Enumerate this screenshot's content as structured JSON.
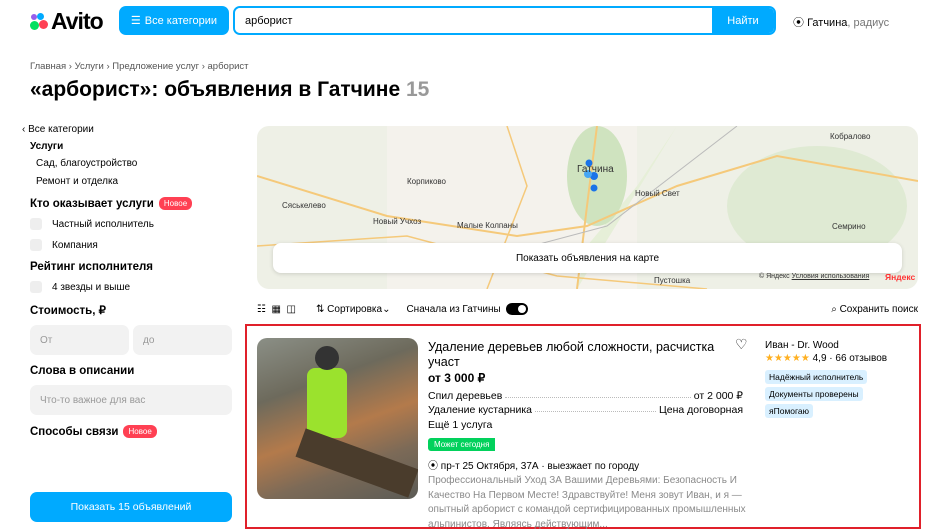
{
  "header": {
    "logo": "Avito",
    "categories_button": "Все категории",
    "search_value": "арборист",
    "search_button": "Найти",
    "location_city": "Гатчина",
    "location_suffix": ", радиус"
  },
  "breadcrumbs": "Главная › Услуги › Предложение услуг › арборист",
  "page_title": "«арборист»: объявления в Гатчине",
  "result_count": "15",
  "sidebar": {
    "back": "Все категории",
    "section": "Услуги",
    "subitems": [
      "Сад, благоустройство",
      "Ремонт и отделка"
    ],
    "provider_title": "Кто оказывает услуги",
    "new_badge": "Новое",
    "provider_options": [
      "Частный исполнитель",
      "Компания"
    ],
    "rating_title": "Рейтинг исполнителя",
    "rating_option": "4 звезды и выше",
    "price_title": "Стоимость, ₽",
    "price_from": "От",
    "price_to": "до",
    "words_title": "Слова в описании",
    "words_placeholder": "Что-то важное для вас",
    "contact_title": "Способы связи",
    "show_button": "Показать 15 объявлений"
  },
  "map": {
    "button": "Показать объявления на карте",
    "copyright": "© Яндекс",
    "terms": "Условия использования",
    "brand": "Яндекс",
    "labels": [
      "Кобралово",
      "Гатчина",
      "Корпиково",
      "Новый Свет",
      "Сяськелево",
      "Новый Учхоз",
      "Малые Колпаны",
      "Семрино",
      "Пустошка"
    ]
  },
  "toolbar": {
    "sort": "Сортировка",
    "gatchina_first": "Сначала из Гатчины",
    "save_search": "Сохранить поиск"
  },
  "listing": {
    "title": "Удаление деревьев любой сложности, расчистка участ",
    "price": "от 3 000 ₽",
    "services": [
      {
        "name": "Спил деревьев",
        "price": "от 2 000 ₽"
      },
      {
        "name": "Удаление кустарника",
        "price": "Цена договорная"
      }
    ],
    "more": "Ещё 1 услуга",
    "today_badge": "Может сегодня",
    "address": "пр-т 25 Октября, 37А · выезжает по городу",
    "description": "Профессиональный Уход ЗА Вашими Деревьями: Безопасность И Качество На Первом Месте! Здравствуйте! Меня зовут Иван, и я — опытный арборист с командой сертифицированных промышленных альпинистов. Являясь действующим...",
    "seller": "Иван - Dr. Wood",
    "stars": "★★★★★",
    "rating": "4,9 · 66 отзывов",
    "tags": [
      "Надёжный исполнитель",
      "Документы проверены",
      "яПомогаю"
    ],
    "accent": "#e0202a"
  }
}
